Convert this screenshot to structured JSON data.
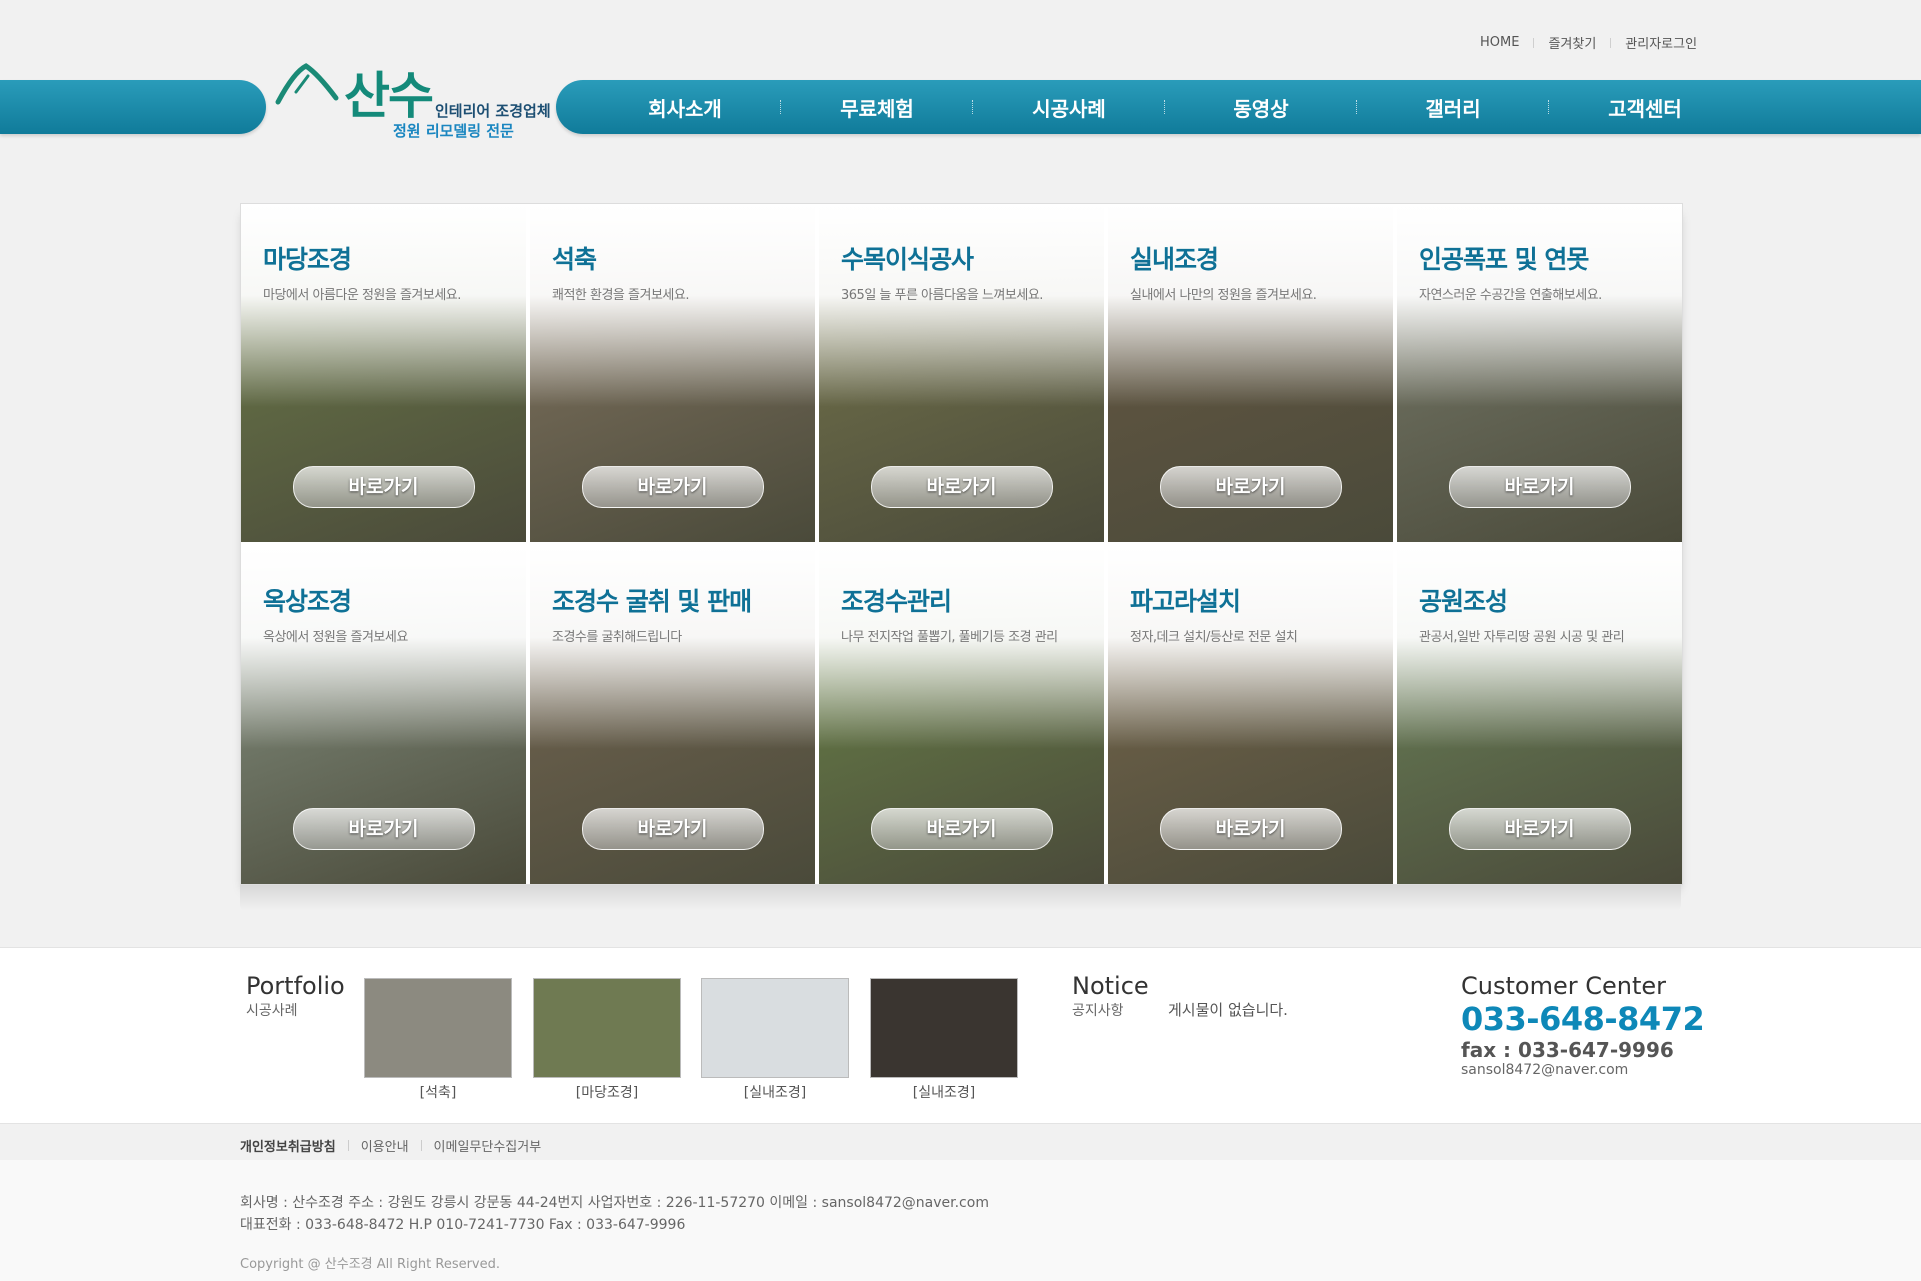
{
  "top_links": [
    "HOME",
    "즐겨찾기",
    "관리자로그인"
  ],
  "logo": {
    "name": "산수",
    "tagline1": "인테리어 조경업체",
    "tagline2": "정원 리모델링 전문"
  },
  "menu": [
    "회사소개",
    "무료체험",
    "시공사례",
    "동영상",
    "갤러리",
    "고객센터"
  ],
  "tiles": [
    {
      "title": "마당조경",
      "desc": "마당에서 아름다운 정원을 즐겨보세요.",
      "button": "바로가기",
      "color": "#6f7f4a"
    },
    {
      "title": "석축",
      "desc": "쾌적한 환경을 즐겨보세요.",
      "button": "바로가기",
      "color": "#8a7a66"
    },
    {
      "title": "수목이식공사",
      "desc": "365일 늘 푸른 아름다움을 느껴보세요.",
      "button": "바로가기",
      "color": "#7a7a4e"
    },
    {
      "title": "실내조경",
      "desc": "실내에서 나만의 정원을 즐겨보세요.",
      "button": "바로가기",
      "color": "#6a5a44"
    },
    {
      "title": "인공폭포 및 연못",
      "desc": "자연스러운 수공간을 연출해보세요.",
      "button": "바로가기",
      "color": "#7d8070"
    },
    {
      "title": "옥상조경",
      "desc": "옥상에서 정원을 즐겨보세요",
      "button": "바로가기",
      "color": "#8d9a8a"
    },
    {
      "title": "조경수 굴취 및 판매",
      "desc": "조경수를 굴취해드립니다",
      "button": "바로가기",
      "color": "#7a6a55"
    },
    {
      "title": "조경수관리",
      "desc": "나무 전지작업 풀뽑기, 풀베기등 조경 관리",
      "button": "바로가기",
      "color": "#6e8a4a"
    },
    {
      "title": "파고라설치",
      "desc": "정자,데크 설치/등산로 전문 설치",
      "button": "바로가기",
      "color": "#7c6a4e"
    },
    {
      "title": "공원조성",
      "desc": "관공서,일반 자투리땅 공원 시공 및 관리",
      "button": "바로가기",
      "color": "#6f8a5c"
    }
  ],
  "portfolio": {
    "title": "Portfolio",
    "subtitle": "시공사례",
    "items": [
      {
        "caption": "[석축]",
        "color": "#8c8a80"
      },
      {
        "caption": "[마당조경]",
        "color": "#6f7a52"
      },
      {
        "caption": "[실내조경]",
        "color": "#d9dde0"
      },
      {
        "caption": "[실내조경]",
        "color": "#3a3530"
      }
    ]
  },
  "notice": {
    "title": "Notice",
    "subtitle": "공지사항",
    "empty": "게시물이 없습니다."
  },
  "customer_center": {
    "title": "Customer Center",
    "phone": "033-648-8472",
    "fax": "fax : 033-647-9996",
    "email": "sansol8472@naver.com"
  },
  "footer_links": [
    "개인정보취급방침",
    "이용안내",
    "이메일무단수집거부"
  ],
  "footer_info": {
    "line1": "회사명 : 산수조경 주소 : 강원도 강릉시 강문동 44-24번지 사업자번호 : 226-11-57270 이메일 : sansol8472@naver.com",
    "line2": "대표전화 : 033-648-8472 H.P 010-7241-7730 Fax : 033-647-9996",
    "copyright": "Copyright @ 산수조경 All Right Reserved."
  }
}
